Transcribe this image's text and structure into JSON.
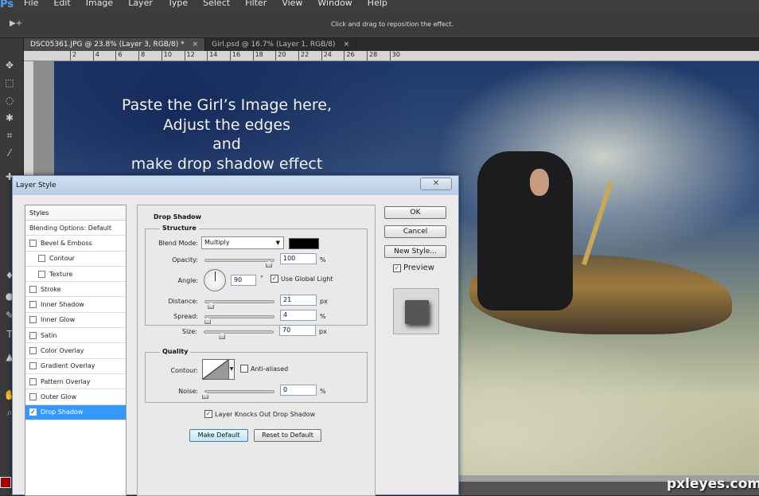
{
  "app": {
    "logo": "Ps",
    "menu": [
      "File",
      "Edit",
      "Image",
      "Layer",
      "Type",
      "Select",
      "Filter",
      "View",
      "Window",
      "Help"
    ]
  },
  "options": {
    "tool_glyph": "▶+",
    "hint": "Click and drag to reposition the effect."
  },
  "tabs": [
    {
      "label": "DSC05361.JPG @ 23.8% (Layer 3, RGB/8) *",
      "close": "×"
    },
    {
      "label": "Girl.psd @ 16.7% (Layer 1, RGB/8)",
      "close": "×"
    }
  ],
  "ruler": [
    "2",
    "4",
    "6",
    "8",
    "10",
    "12",
    "14",
    "16",
    "18",
    "20",
    "22",
    "24",
    "26",
    "28",
    "30"
  ],
  "canvas": {
    "text_lines": [
      "Paste the Girl’s Image here,",
      "Adjust the edges",
      "and",
      "make drop shadow effect"
    ]
  },
  "watermark": "pxleyes.com",
  "dialog": {
    "title": "Layer Style",
    "close": "✕",
    "styles_header": "Styles",
    "styles": [
      {
        "label": "Blending Options: Default",
        "checkbox": false,
        "checked": false,
        "indent": false,
        "selected": false
      },
      {
        "label": "Bevel & Emboss",
        "checkbox": true,
        "checked": false,
        "indent": false,
        "selected": false
      },
      {
        "label": "Contour",
        "checkbox": true,
        "checked": false,
        "indent": true,
        "selected": false
      },
      {
        "label": "Texture",
        "checkbox": true,
        "checked": false,
        "indent": true,
        "selected": false
      },
      {
        "label": "Stroke",
        "checkbox": true,
        "checked": false,
        "indent": false,
        "selected": false
      },
      {
        "label": "Inner Shadow",
        "checkbox": true,
        "checked": false,
        "indent": false,
        "selected": false
      },
      {
        "label": "Inner Glow",
        "checkbox": true,
        "checked": false,
        "indent": false,
        "selected": false
      },
      {
        "label": "Satin",
        "checkbox": true,
        "checked": false,
        "indent": false,
        "selected": false
      },
      {
        "label": "Color Overlay",
        "checkbox": true,
        "checked": false,
        "indent": false,
        "selected": false
      },
      {
        "label": "Gradient Overlay",
        "checkbox": true,
        "checked": false,
        "indent": false,
        "selected": false
      },
      {
        "label": "Pattern Overlay",
        "checkbox": true,
        "checked": false,
        "indent": false,
        "selected": false
      },
      {
        "label": "Outer Glow",
        "checkbox": true,
        "checked": false,
        "indent": false,
        "selected": false
      },
      {
        "label": "Drop Shadow",
        "checkbox": true,
        "checked": true,
        "indent": false,
        "selected": true
      }
    ],
    "panel_title": "Drop Shadow",
    "structure": {
      "label": "Structure",
      "blend_mode_label": "Blend Mode:",
      "blend_mode": "Multiply",
      "shadow_color": "#000000",
      "opacity_label": "Opacity:",
      "opacity": "100",
      "opacity_frac": 1.0,
      "angle_label": "Angle:",
      "angle": "90",
      "degree": "°",
      "global_light_label": "Use Global Light",
      "global_light": true,
      "distance_label": "Distance:",
      "distance": "21",
      "distance_frac": 0.09,
      "spread_label": "Spread:",
      "spread": "4",
      "spread_frac": 0.04,
      "size_label": "Size:",
      "size": "70",
      "size_frac": 0.28,
      "px": "px",
      "pct": "%"
    },
    "quality": {
      "label": "Quality",
      "contour_label": "Contour:",
      "anti_aliased_label": "Anti-aliased",
      "anti_aliased": false,
      "noise_label": "Noise:",
      "noise": "0",
      "noise_frac": 0.0
    },
    "knocks_out_label": "Layer Knocks Out Drop Shadow",
    "knocks_out": true,
    "make_default": "Make Default",
    "reset_default": "Reset to Default",
    "ok": "OK",
    "cancel": "Cancel",
    "new_style": "New Style...",
    "preview_label": "Preview",
    "preview": true
  }
}
